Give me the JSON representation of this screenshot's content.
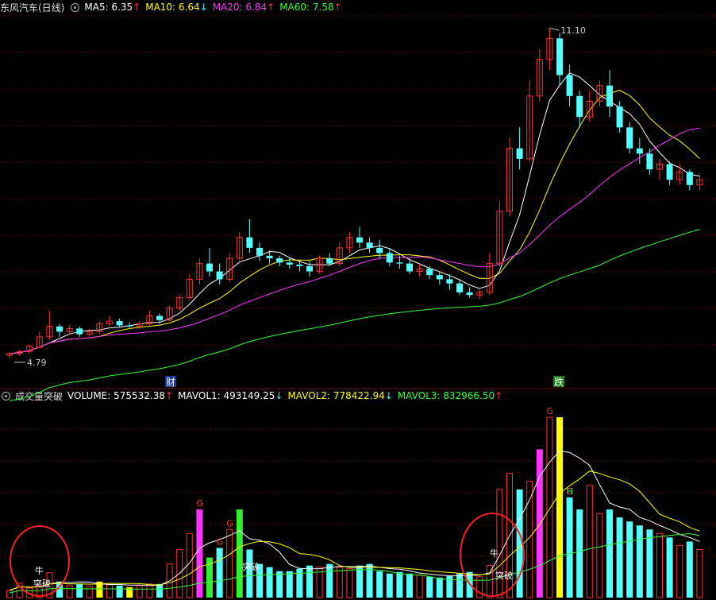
{
  "price_panel": {
    "title": "东风汽车(日线)",
    "indicators": [
      {
        "name": "MA5:",
        "value": "6.35",
        "trend": "up",
        "color": "#ffffff"
      },
      {
        "name": "MA10:",
        "value": "6.64",
        "trend": "down",
        "color": "#ffff00"
      },
      {
        "name": "MA20:",
        "value": "6.84",
        "trend": "up",
        "color": "#ff33ff"
      },
      {
        "name": "MA60:",
        "value": "7.58",
        "trend": "up",
        "color": "#33ff33"
      }
    ],
    "high_label": "11.10",
    "low_label": "4.79",
    "markers": [
      {
        "text": "财"
      },
      {
        "text": "跌"
      }
    ]
  },
  "volume_panel": {
    "title": "成交量突破",
    "indicators": [
      {
        "name": "VOLUME:",
        "value": "575532.38",
        "trend": "up",
        "color": "#ffffff"
      },
      {
        "name": "MAVOL1:",
        "value": "493149.25",
        "trend": "down",
        "color": "#ffffff"
      },
      {
        "name": "MAVOL2:",
        "value": "778422.94",
        "trend": "down",
        "color": "#ffff00"
      },
      {
        "name": "MAVOL3:",
        "value": "832966.50",
        "trend": "up",
        "color": "#33ff33"
      }
    ],
    "signal_labels": [
      "牛",
      "突破",
      "突破",
      "牛",
      "突破"
    ],
    "g_label": "G",
    "h_label": "H"
  },
  "colors": {
    "up": "#ff3232",
    "down": "#54ffff",
    "ma5": "#ffffff",
    "ma10": "#ffff00",
    "ma20": "#ff33ff",
    "ma60": "#33ff33",
    "grid": "#6a0000"
  },
  "chart_data": {
    "type": "candlestick",
    "y_range": [
      4.5,
      11.3
    ],
    "candles": [
      [
        4.85,
        4.9,
        4.79,
        4.88
      ],
      [
        4.88,
        4.95,
        4.84,
        4.92
      ],
      [
        4.92,
        5.05,
        4.88,
        5.02
      ],
      [
        5.0,
        5.3,
        4.98,
        5.2
      ],
      [
        5.2,
        5.7,
        5.15,
        5.4
      ],
      [
        5.4,
        5.45,
        5.2,
        5.3
      ],
      [
        5.3,
        5.42,
        5.25,
        5.36
      ],
      [
        5.36,
        5.4,
        5.2,
        5.25
      ],
      [
        5.25,
        5.35,
        5.2,
        5.3
      ],
      [
        5.3,
        5.5,
        5.25,
        5.45
      ],
      [
        5.45,
        5.6,
        5.4,
        5.5
      ],
      [
        5.5,
        5.55,
        5.38,
        5.42
      ],
      [
        5.42,
        5.48,
        5.35,
        5.4
      ],
      [
        5.4,
        5.5,
        5.35,
        5.45
      ],
      [
        5.45,
        5.7,
        5.42,
        5.6
      ],
      [
        5.6,
        5.65,
        5.45,
        5.52
      ],
      [
        5.52,
        5.8,
        5.5,
        5.75
      ],
      [
        5.75,
        6.0,
        5.7,
        5.95
      ],
      [
        5.95,
        6.4,
        5.9,
        6.3
      ],
      [
        6.3,
        6.7,
        6.2,
        6.6
      ],
      [
        6.6,
        6.9,
        6.35,
        6.45
      ],
      [
        6.45,
        6.6,
        6.2,
        6.3
      ],
      [
        6.3,
        6.8,
        6.25,
        6.7
      ],
      [
        6.7,
        7.2,
        6.6,
        7.1
      ],
      [
        7.1,
        7.45,
        6.8,
        6.9
      ],
      [
        6.9,
        7.0,
        6.65,
        6.75
      ],
      [
        6.75,
        6.85,
        6.6,
        6.7
      ],
      [
        6.7,
        6.75,
        6.55,
        6.62
      ],
      [
        6.62,
        6.7,
        6.5,
        6.58
      ],
      [
        6.58,
        6.68,
        6.45,
        6.55
      ],
      [
        6.55,
        6.65,
        6.35,
        6.45
      ],
      [
        6.45,
        6.75,
        6.4,
        6.7
      ],
      [
        6.7,
        6.8,
        6.55,
        6.6
      ],
      [
        6.6,
        7.0,
        6.55,
        6.9
      ],
      [
        6.9,
        7.2,
        6.8,
        7.1
      ],
      [
        7.1,
        7.3,
        6.9,
        7.0
      ],
      [
        7.0,
        7.1,
        6.8,
        6.9
      ],
      [
        6.9,
        7.05,
        6.7,
        6.8
      ],
      [
        6.8,
        6.9,
        6.55,
        6.62
      ],
      [
        6.62,
        6.75,
        6.5,
        6.6
      ],
      [
        6.6,
        6.7,
        6.4,
        6.45
      ],
      [
        6.45,
        6.6,
        6.35,
        6.5
      ],
      [
        6.5,
        6.55,
        6.3,
        6.38
      ],
      [
        6.38,
        6.45,
        6.2,
        6.3
      ],
      [
        6.3,
        6.4,
        6.1,
        6.22
      ],
      [
        6.22,
        6.3,
        6.0,
        6.05
      ],
      [
        6.05,
        6.15,
        5.95,
        6.0
      ],
      [
        6.0,
        6.1,
        5.92,
        6.05
      ],
      [
        6.05,
        6.8,
        6.0,
        6.6
      ],
      [
        6.6,
        7.8,
        6.55,
        7.6
      ],
      [
        7.6,
        9.0,
        7.5,
        8.8
      ],
      [
        8.8,
        9.2,
        8.4,
        8.6
      ],
      [
        8.6,
        10.1,
        8.55,
        9.8
      ],
      [
        9.8,
        10.7,
        9.7,
        10.5
      ],
      [
        10.5,
        11.1,
        10.3,
        10.9
      ],
      [
        10.9,
        11.0,
        10.0,
        10.2
      ],
      [
        10.2,
        10.4,
        9.6,
        9.8
      ],
      [
        9.8,
        9.9,
        9.2,
        9.4
      ],
      [
        9.4,
        9.9,
        9.3,
        9.7
      ],
      [
        9.7,
        10.1,
        9.6,
        10.0
      ],
      [
        10.0,
        10.3,
        9.4,
        9.6
      ],
      [
        9.6,
        9.7,
        9.1,
        9.2
      ],
      [
        9.2,
        9.3,
        8.7,
        8.8
      ],
      [
        8.8,
        9.0,
        8.5,
        8.7
      ],
      [
        8.7,
        8.8,
        8.3,
        8.4
      ],
      [
        8.4,
        8.6,
        8.2,
        8.5
      ],
      [
        8.5,
        8.55,
        8.1,
        8.2
      ],
      [
        8.2,
        8.5,
        8.1,
        8.35
      ],
      [
        8.35,
        8.4,
        8.0,
        8.1
      ],
      [
        8.1,
        8.3,
        8.0,
        8.2
      ]
    ],
    "volume_range": [
      0,
      2300000
    ],
    "volume": [
      90000,
      180000,
      120000,
      150000,
      310000,
      200000,
      150000,
      170000,
      140000,
      200000,
      160000,
      150000,
      130000,
      150000,
      170000,
      170000,
      420000,
      600000,
      800000,
      1100000,
      500000,
      620000,
      850000,
      1100000,
      600000,
      420000,
      380000,
      330000,
      330000,
      360000,
      400000,
      380000,
      420000,
      380000,
      360000,
      400000,
      420000,
      330000,
      300000,
      320000,
      300000,
      280000,
      260000,
      250000,
      270000,
      300000,
      320000,
      260000,
      400000,
      1350000,
      1550000,
      1350000,
      1450000,
      1850000,
      2250000,
      2250000,
      1250000,
      1100000,
      1400000,
      1050000,
      1100000,
      1000000,
      950000,
      900000,
      850000,
      800000,
      750000,
      650000,
      700000,
      600000
    ]
  }
}
